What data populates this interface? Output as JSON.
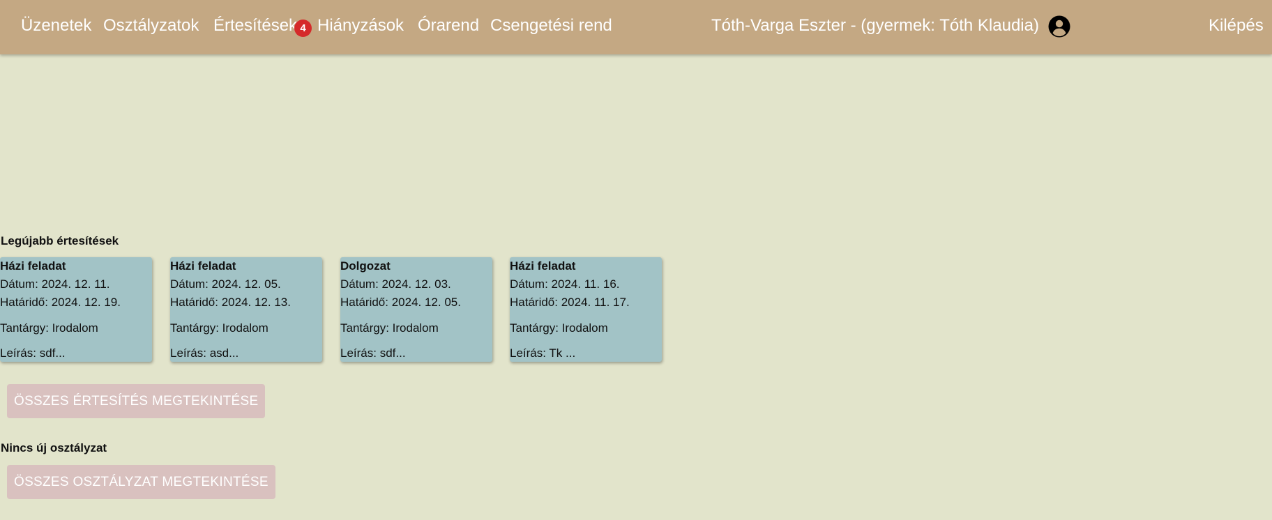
{
  "nav": {
    "items": [
      {
        "label": "Üzenetek"
      },
      {
        "label": "Osztályzatok"
      },
      {
        "label": "Értesítések"
      },
      {
        "label": "Hiányzások"
      },
      {
        "label": "Órarend"
      },
      {
        "label": "Csengetési rend"
      }
    ],
    "notification_count": "4",
    "user": "Tóth-Varga Eszter - (gyermek: Tóth Klaudia)",
    "avatar_icon": "account-circle-icon",
    "logout": "Kilépés"
  },
  "notifications": {
    "title": "Legújabb értesítések",
    "cards": [
      {
        "type": "Házi feladat",
        "date": "Dátum: 2024. 12. 11.",
        "deadline": "Határidő: 2024. 12. 19.",
        "subject": "Tantárgy: Irodalom",
        "description": "Leírás: sdf..."
      },
      {
        "type": "Házi feladat",
        "date": "Dátum: 2024. 12. 05.",
        "deadline": "Határidő: 2024. 12. 13.",
        "subject": "Tantárgy: Irodalom",
        "description": "Leírás: asd..."
      },
      {
        "type": "Dolgozat",
        "date": "Dátum: 2024. 12. 03.",
        "deadline": "Határidő: 2024. 12. 05.",
        "subject": "Tantárgy: Irodalom",
        "description": "Leírás: sdf..."
      },
      {
        "type": "Házi feladat",
        "date": "Dátum: 2024. 11. 16.",
        "deadline": "Határidő: 2024. 11. 17.",
        "subject": "Tantárgy: Irodalom",
        "description": "Leírás: Tk ..."
      }
    ],
    "view_all_button": "ÖSSZES ÉRTESÍTÉS MEGTEKINTÉSE"
  },
  "grades": {
    "status": "Nincs új osztályzat",
    "view_all_button": "ÖSSZES OSZTÁLYZAT MEGTEKINTÉSE"
  },
  "colors": {
    "navbar": "#c4a883",
    "background": "#e2e4cb",
    "card": "#a2c3c6",
    "button": "#d9c1bf",
    "badge": "#d52a2a"
  }
}
